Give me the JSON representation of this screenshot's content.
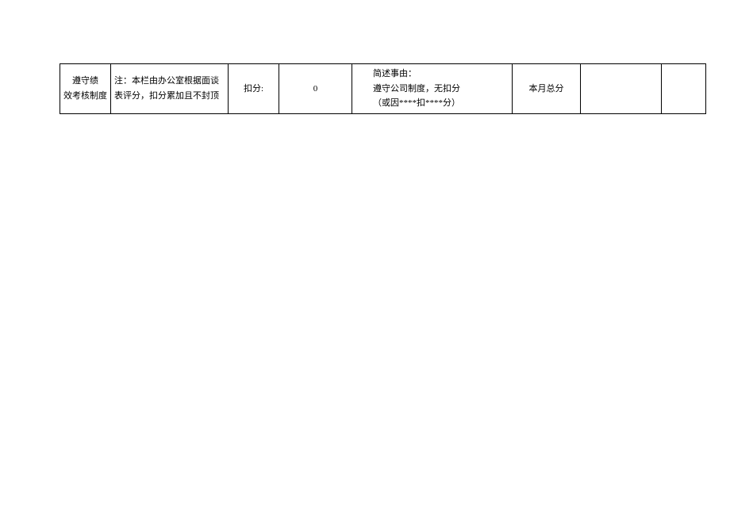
{
  "row": {
    "col1_line1": "遵守绩",
    "col1_line2": "效考核制度",
    "col2": "注：本栏由办公室根据面谈表评分，扣分累加且不封顶",
    "col3": "扣分:",
    "col4": "0",
    "col5_line1": "简述事由：",
    "col5_line2": "遵守公司制度，无扣分",
    "col5_line3": "（或因****扣****分）",
    "col6": "本月总分",
    "col7": "",
    "col8": ""
  }
}
